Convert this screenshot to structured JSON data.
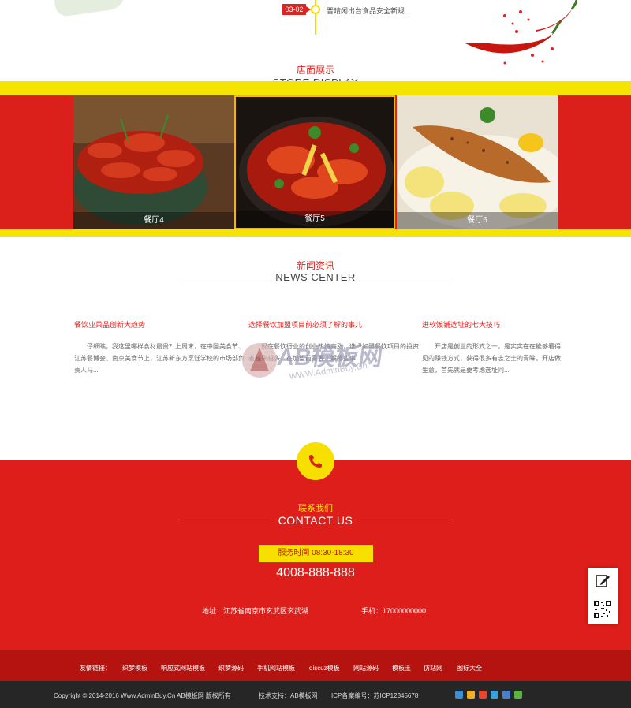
{
  "timeline": {
    "date": "03-02",
    "text": "晋晴闲出台食品安全新规..."
  },
  "store": {
    "title_cn": "店面展示",
    "title_en": "STORE DISPLAY",
    "items": [
      {
        "caption": "餐厅4"
      },
      {
        "caption": "餐厅5"
      },
      {
        "caption": "餐厅6"
      }
    ]
  },
  "news": {
    "title_cn": "新闻资讯",
    "title_en": "NEWS CENTER",
    "items": [
      {
        "title": "餐饮业菜品创新大趋势",
        "summary": "仔细瞧，我这里哪样食材最贵？上周末，在中国美食节、江苏餐博会、南京美食节上，江苏新东方烹饪学校的市场部负责人马..."
      },
      {
        "title": "选择餐饮加盟项目前必须了解的事儿",
        "summary": "现在餐饮行业的创业热情高涨，选择加盟餐饮项目的投资者越来越多，在加盟前需要了解哪些事..."
      },
      {
        "title": "进软饭铺选址的七大技巧",
        "summary": "开店是创业的形式之一，是实实在在能够看得见的赚钱方式，获得很多有志之士的青睐。开店做生意，首先就是要考虑选址问..."
      }
    ]
  },
  "watermark": {
    "line1": "AB模板网",
    "line2": "WWW.AdminBuy.Cn"
  },
  "contact": {
    "title_cn": "联系我们",
    "title_en": "CONTACT US",
    "hours": "服务时间 08:30-18:30",
    "hotline": "4008-888-888",
    "address": "地址：江苏省南京市玄武区玄武湖",
    "mobile": "手机：17000000000"
  },
  "links": {
    "label": "友情链接：",
    "items": [
      "织梦模板",
      "响应式网站模板",
      "织梦源码",
      "手机网站模板",
      "discuz模板",
      "网站源码",
      "模板王",
      "仿站网",
      "图标大全"
    ]
  },
  "footer": {
    "copyright": "Copyright © 2014-2016 Www.AdminBuy.Cn AB模板网 版权所有",
    "support": "技术支持：AB模板网",
    "icp": "ICP备案编号：苏ICP12345678"
  },
  "colors": {
    "brand_red": "#dd1e1a",
    "brand_yellow": "#f7e000",
    "dark": "#262626"
  },
  "icons": [
    "phone-icon",
    "edit-icon",
    "qr-code-icon",
    "share-icons"
  ]
}
